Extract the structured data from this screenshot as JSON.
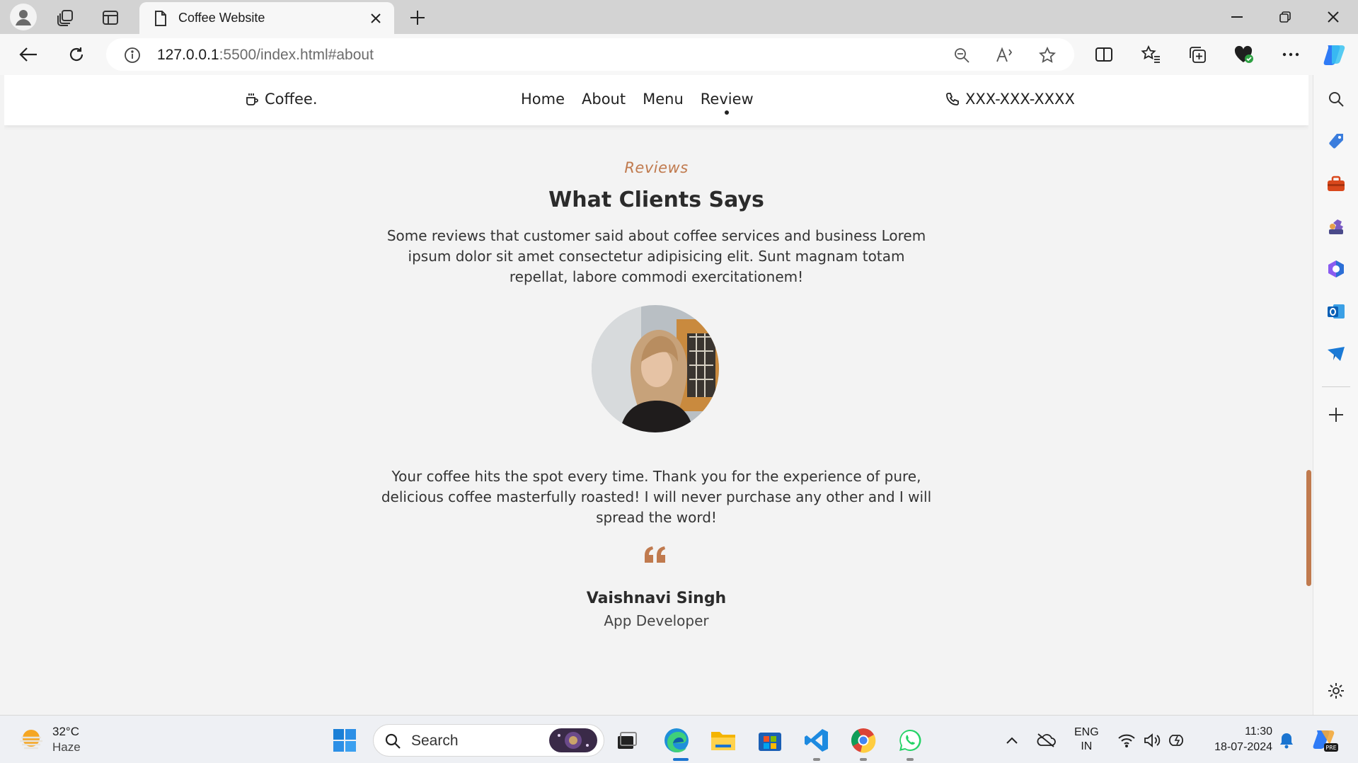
{
  "browser": {
    "tab_title": "Coffee Website",
    "url_host": "127.0.0.1",
    "url_rest": ":5500/index.html#about"
  },
  "site": {
    "logo_text": "Coffee.",
    "nav": [
      "Home",
      "About",
      "Menu",
      "Review"
    ],
    "active_nav": "Review",
    "phone": "XXX-XXX-XXXX",
    "accent_color": "#c07a4e"
  },
  "reviews": {
    "eyebrow": "Reviews",
    "heading": "What Clients Says",
    "intro": "Some reviews that customer said about coffee services and business Lorem ipsum dolor sit amet consectetur adipisicing elit. Sunt magnam totam repellat, labore commodi exercitationem!",
    "quote": "Your coffee hits the spot every time. Thank you for the experience of pure, delicious coffee masterfully roasted! I will never purchase any other and I will spread the word!",
    "reviewer_name": "Vaishnavi Singh",
    "reviewer_role": "App Developer"
  },
  "taskbar": {
    "temperature": "32°C",
    "weather": "Haze",
    "search_placeholder": "Search",
    "lang_line1": "ENG",
    "lang_line2": "IN",
    "time": "11:30",
    "date": "18-07-2024"
  }
}
